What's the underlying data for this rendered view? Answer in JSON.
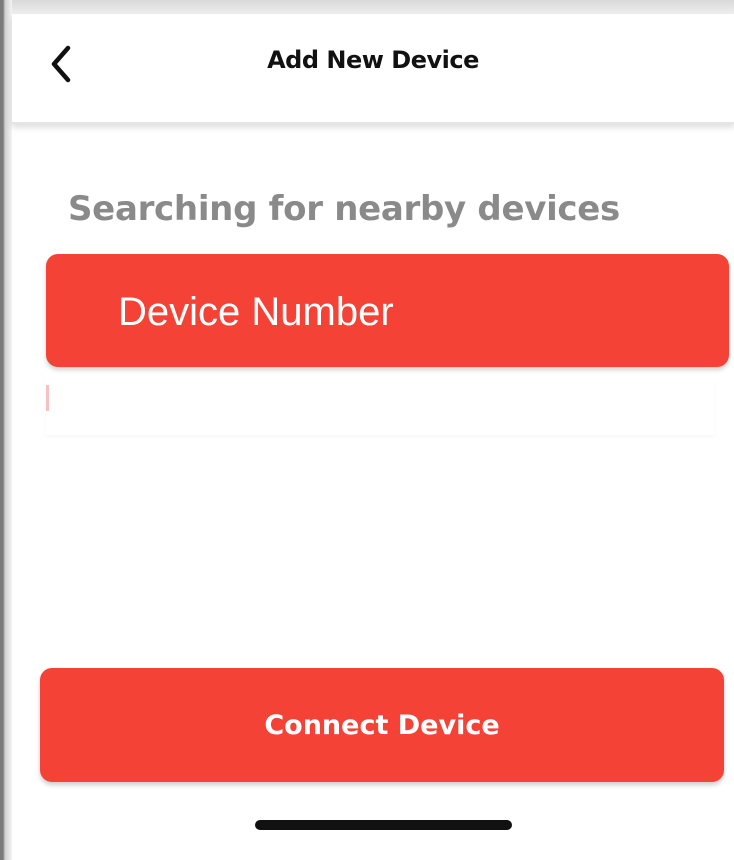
{
  "header": {
    "back_icon": "chevron-left-icon",
    "title": "Add New Device"
  },
  "main": {
    "status_text": "Searching for nearby devices",
    "devices": [
      {
        "label": "Device Number",
        "selected": true
      }
    ]
  },
  "footer": {
    "connect_label": "Connect Device"
  },
  "colors": {
    "accent": "#f44336",
    "status_text": "#8a8a8a",
    "title_text": "#111111"
  }
}
